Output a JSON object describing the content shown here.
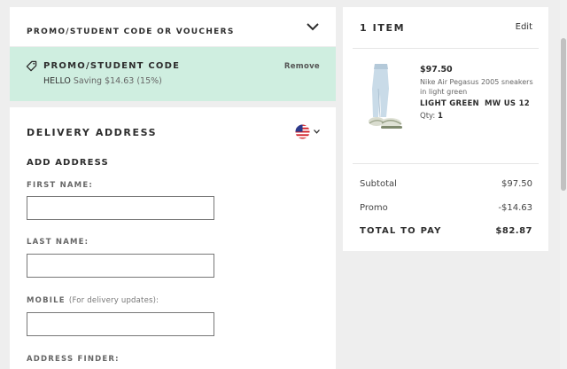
{
  "promo": {
    "title": "PROMO/STUDENT CODE OR VOUCHERS"
  },
  "applied": {
    "title": "PROMO/STUDENT CODE",
    "remove": "Remove",
    "code": "HELLO",
    "saving": "Saving $14.63 (15%)"
  },
  "delivery": {
    "title": "DELIVERY ADDRESS",
    "add_address": "ADD ADDRESS",
    "first_name_label": "FIRST NAME:",
    "last_name_label": "LAST NAME:",
    "mobile_label": "MOBILE",
    "mobile_hint": "(For delivery updates):",
    "address_finder_label": "ADDRESS FINDER:",
    "first_name_value": "",
    "last_name_value": "",
    "mobile_value": ""
  },
  "order": {
    "items_title": "1 ITEM",
    "edit": "Edit",
    "item": {
      "price": "$97.50",
      "name": "Nike Air Pegasus 2005 sneakers in light green",
      "colour": "LIGHT GREEN",
      "size": "MW US 12",
      "qty_label": "Qty:",
      "qty": "1"
    },
    "subtotal_label": "Subtotal",
    "subtotal": "$97.50",
    "promo_label": "Promo",
    "promo": "-$14.63",
    "total_label": "TOTAL TO PAY",
    "total": "$82.87"
  },
  "colors": {
    "applied_bg": "#cfeee0",
    "page_bg": "#eeeeee"
  },
  "icons": [
    "chevron-down-icon",
    "tag-icon",
    "us-flag-icon"
  ]
}
